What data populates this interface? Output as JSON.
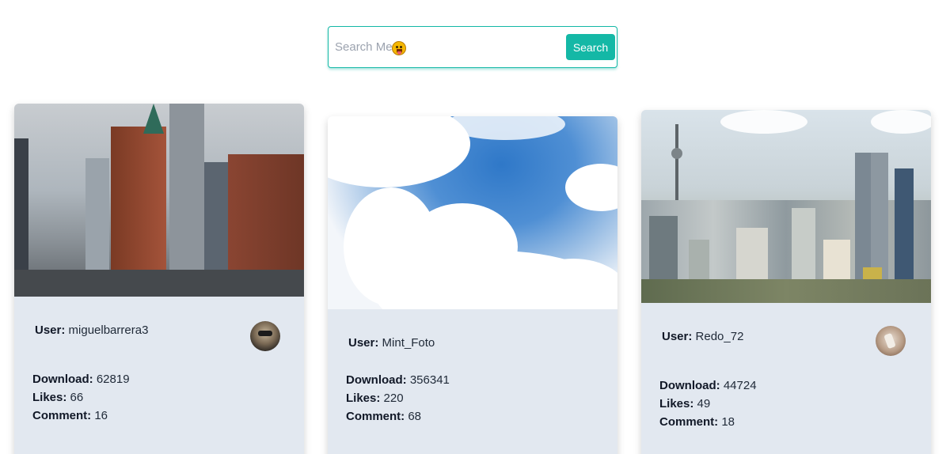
{
  "search": {
    "placeholder": "Search Me",
    "emoji": "face-with-tongue-icon",
    "button_label": "Search"
  },
  "colors": {
    "accent": "#14b8a6",
    "card_bg": "#e2e8f0"
  },
  "labels": {
    "user": "User:",
    "download": "Download:",
    "likes": "Likes:",
    "comment": "Comment:"
  },
  "cards": [
    {
      "image": "city-street-flatiron-photo",
      "user": "miguelbarrera3",
      "avatar": "user-avatar-1",
      "download": "62819",
      "likes": "66",
      "comment": "16"
    },
    {
      "image": "cloudy-blue-sky-photo",
      "user": "Mint_Foto",
      "avatar": "",
      "download": "356341",
      "likes": "220",
      "comment": "68"
    },
    {
      "image": "city-skyline-towers-photo",
      "user": "Redo_72",
      "avatar": "user-avatar-3",
      "download": "44724",
      "likes": "49",
      "comment": "18"
    }
  ]
}
